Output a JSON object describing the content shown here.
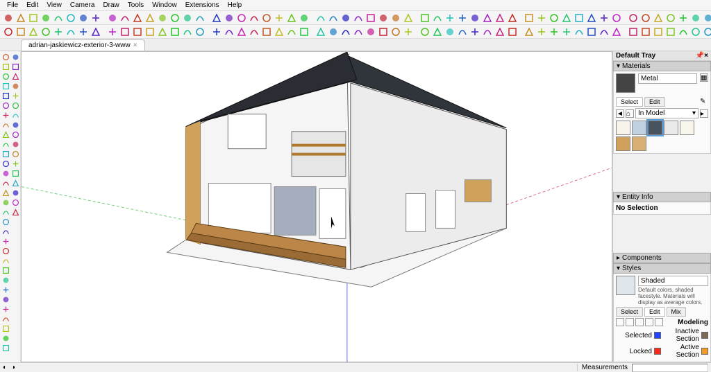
{
  "menu": [
    "File",
    "Edit",
    "View",
    "Camera",
    "Draw",
    "Tools",
    "Window",
    "Extensions",
    "Help"
  ],
  "tab": {
    "label": "adrian-jaskiewicz-exterior-3-www"
  },
  "tray": {
    "title": "Default Tray",
    "materials": {
      "title": "Materials",
      "current": "Metal",
      "select_tab": "Select",
      "edit_tab": "Edit",
      "collection": "In Model",
      "swatches": [
        {
          "c": "#f7f4ea"
        },
        {
          "c": "#c0d2e2"
        },
        {
          "c": "#46525e",
          "sel": true
        },
        {
          "c": "#eaeaea"
        },
        {
          "c": "#f9f6ee"
        },
        {
          "c": "#cfa15a"
        },
        {
          "c": "#d9ae74"
        }
      ]
    },
    "entity": {
      "title": "Entity Info",
      "text": "No Selection"
    },
    "components": {
      "title": "Components"
    },
    "styles": {
      "title": "Styles",
      "name": "Shaded",
      "desc": "Default colors, shaded facestyle. Materials will display as average colors.",
      "select_tab": "Select",
      "edit_tab": "Edit",
      "mix_tab": "Mix",
      "modeling": "Modeling",
      "legend": [
        {
          "label": "Selected",
          "c": "#2442ff"
        },
        {
          "label": "Inactive Section",
          "c": "#7a6a55"
        },
        {
          "label": "Locked",
          "c": "#ff2a1a"
        },
        {
          "label": "Active Section",
          "c": "#f59a22"
        }
      ]
    }
  },
  "status": {
    "measurements_label": "Measurements"
  }
}
